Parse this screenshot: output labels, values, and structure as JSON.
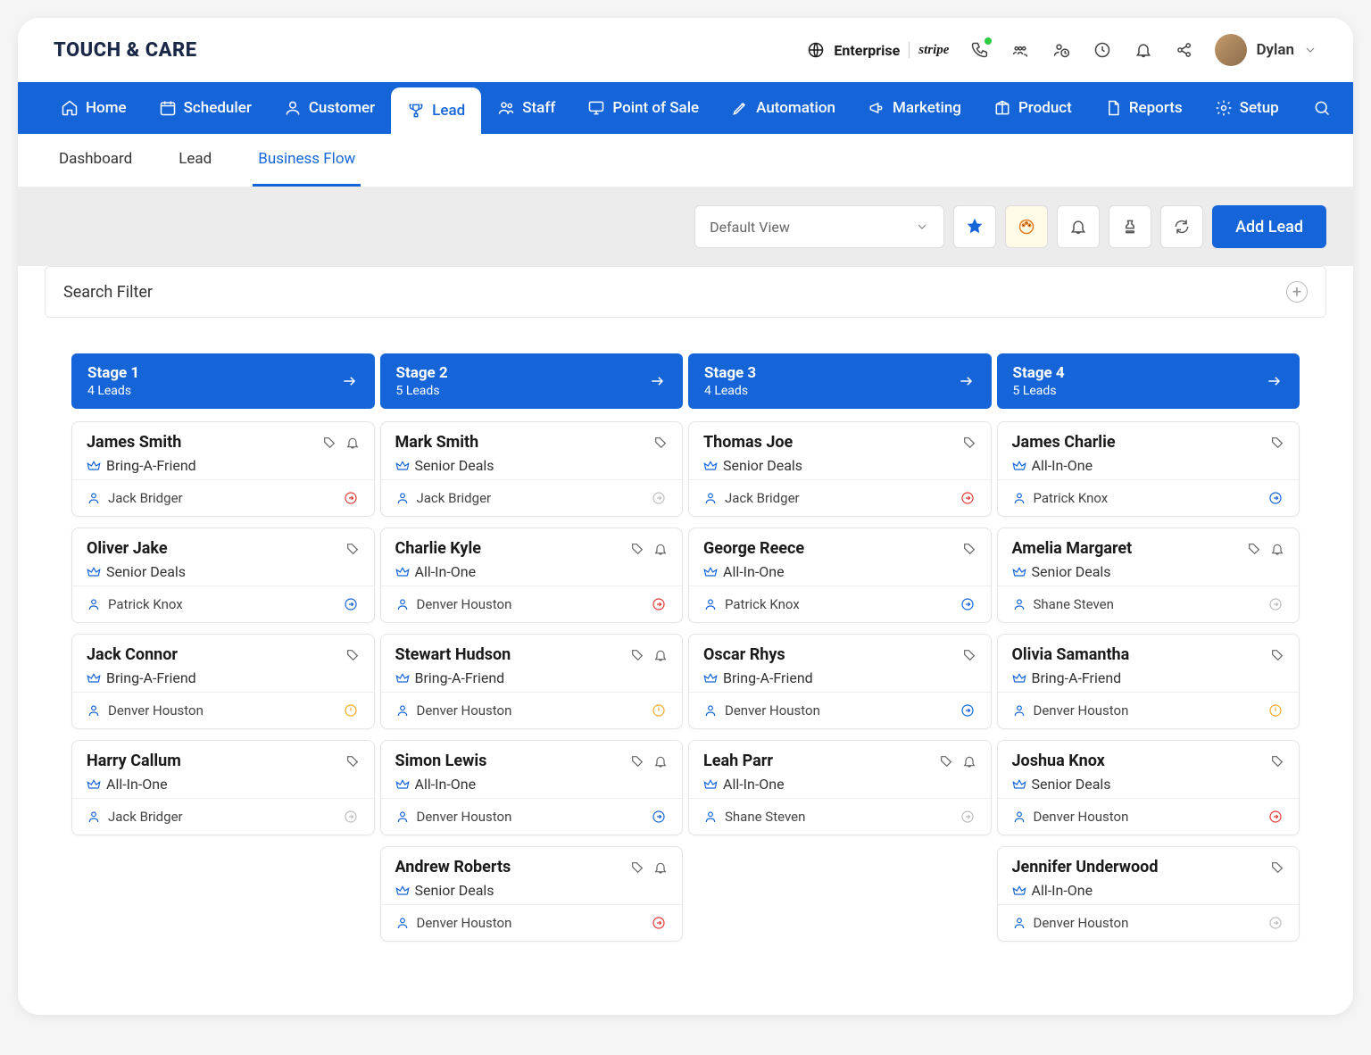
{
  "brand": "TOUCH & CARE",
  "header": {
    "enterprise_label": "Enterprise",
    "partner_label": "stripe",
    "user_name": "Dylan"
  },
  "nav": [
    {
      "label": "Home",
      "icon": "home"
    },
    {
      "label": "Scheduler",
      "icon": "calendar"
    },
    {
      "label": "Customer",
      "icon": "user"
    },
    {
      "label": "Lead",
      "icon": "trophy",
      "active": true
    },
    {
      "label": "Staff",
      "icon": "users"
    },
    {
      "label": "Point of Sale",
      "icon": "monitor"
    },
    {
      "label": "Automation",
      "icon": "pencil"
    },
    {
      "label": "Marketing",
      "icon": "megaphone"
    },
    {
      "label": "Product",
      "icon": "package"
    },
    {
      "label": "Reports",
      "icon": "file"
    },
    {
      "label": "Setup",
      "icon": "gear"
    }
  ],
  "subnav": [
    {
      "label": "Dashboard"
    },
    {
      "label": "Lead"
    },
    {
      "label": "Business Flow",
      "active": true
    }
  ],
  "toolbar": {
    "view_label": "Default View",
    "add_lead_label": "Add Lead"
  },
  "search_filter_label": "Search Filter",
  "stages": [
    {
      "title": "Stage 1",
      "count": "4 Leads",
      "cards": [
        {
          "name": "James Smith",
          "deal": "Bring-A-Friend",
          "owner": "Jack Bridger",
          "icons": [
            "tag",
            "bell"
          ],
          "status": "red"
        },
        {
          "name": "Oliver Jake",
          "deal": "Senior Deals",
          "owner": "Patrick Knox",
          "icons": [
            "tag"
          ],
          "status": "blue"
        },
        {
          "name": "Jack Connor",
          "deal": "Bring-A-Friend",
          "owner": "Denver Houston",
          "icons": [
            "tag"
          ],
          "status": "yellow"
        },
        {
          "name": "Harry Callum",
          "deal": "All-In-One",
          "owner": "Jack Bridger",
          "icons": [
            "tag"
          ],
          "status": "grey"
        }
      ]
    },
    {
      "title": "Stage 2",
      "count": "5 Leads",
      "cards": [
        {
          "name": "Mark Smith",
          "deal": "Senior Deals",
          "owner": "Jack Bridger",
          "icons": [
            "tag"
          ],
          "status": "grey"
        },
        {
          "name": "Charlie Kyle",
          "deal": "All-In-One",
          "owner": "Denver Houston",
          "icons": [
            "tag",
            "bell"
          ],
          "status": "red"
        },
        {
          "name": "Stewart Hudson",
          "deal": "Bring-A-Friend",
          "owner": "Denver Houston",
          "icons": [
            "tag",
            "bell"
          ],
          "status": "yellow"
        },
        {
          "name": "Simon Lewis",
          "deal": "All-In-One",
          "owner": "Denver Houston",
          "icons": [
            "tag",
            "bell"
          ],
          "status": "blue"
        },
        {
          "name": "Andrew Roberts",
          "deal": "Senior Deals",
          "owner": "Denver Houston",
          "icons": [
            "tag",
            "bell"
          ],
          "status": "red"
        }
      ]
    },
    {
      "title": "Stage 3",
      "count": "4 Leads",
      "cards": [
        {
          "name": "Thomas Joe",
          "deal": "Senior Deals",
          "owner": "Jack Bridger",
          "icons": [
            "tag"
          ],
          "status": "red"
        },
        {
          "name": "George Reece",
          "deal": "All-In-One",
          "owner": "Patrick Knox",
          "icons": [
            "tag"
          ],
          "status": "blue"
        },
        {
          "name": "Oscar Rhys",
          "deal": "Bring-A-Friend",
          "owner": "Denver Houston",
          "icons": [
            "tag"
          ],
          "status": "blue"
        },
        {
          "name": "Leah Parr",
          "deal": "All-In-One",
          "owner": "Shane Steven",
          "icons": [
            "tag",
            "bell"
          ],
          "status": "grey"
        }
      ]
    },
    {
      "title": "Stage 4",
      "count": "5 Leads",
      "cards": [
        {
          "name": "James Charlie",
          "deal": "All-In-One",
          "owner": "Patrick Knox",
          "icons": [
            "tag"
          ],
          "status": "blue"
        },
        {
          "name": "Amelia Margaret",
          "deal": "Senior Deals",
          "owner": "Shane Steven",
          "icons": [
            "tag",
            "bell"
          ],
          "status": "grey"
        },
        {
          "name": "Olivia Samantha",
          "deal": "Bring-A-Friend",
          "owner": "Denver Houston",
          "icons": [
            "tag"
          ],
          "status": "yellow"
        },
        {
          "name": "Joshua Knox",
          "deal": "Senior Deals",
          "owner": "Denver Houston",
          "icons": [
            "tag"
          ],
          "status": "red"
        },
        {
          "name": "Jennifer Underwood",
          "deal": "All-In-One",
          "owner": "Denver Houston",
          "icons": [
            "tag"
          ],
          "status": "grey"
        }
      ]
    }
  ],
  "status_colors": {
    "red": "#e53935",
    "blue": "#1565d8",
    "yellow": "#f9a825",
    "grey": "#bdbdbd"
  }
}
